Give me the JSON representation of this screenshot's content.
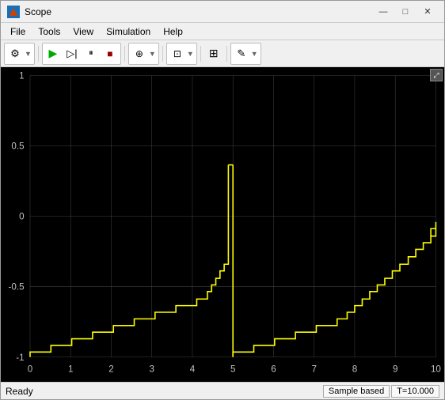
{
  "window": {
    "title": "Scope",
    "title_icon_color": "#d04000"
  },
  "titlebar_buttons": {
    "minimize": "—",
    "maximize": "□",
    "close": "✕"
  },
  "menu": {
    "items": [
      "File",
      "Tools",
      "View",
      "Simulation",
      "Help"
    ]
  },
  "toolbar": {
    "buttons": [
      {
        "name": "settings",
        "icon": "⚙"
      },
      {
        "name": "run",
        "icon": "▶"
      },
      {
        "name": "play",
        "icon": "▷"
      },
      {
        "name": "pause",
        "icon": "⏸"
      },
      {
        "name": "stop",
        "icon": "■"
      },
      {
        "name": "zoom-in",
        "icon": "🔍"
      },
      {
        "name": "zoom-box",
        "icon": "⊡"
      },
      {
        "name": "axes",
        "icon": "⊞"
      },
      {
        "name": "edit",
        "icon": "✎"
      }
    ]
  },
  "chart": {
    "background": "#000000",
    "grid_color": "#404040",
    "line_color": "#ffff00",
    "x_min": 0,
    "x_max": 10,
    "y_min": -1,
    "y_max": 1,
    "x_labels": [
      "0",
      "1",
      "2",
      "3",
      "4",
      "5",
      "6",
      "7",
      "8",
      "9",
      "10"
    ],
    "y_labels": [
      "-1",
      "-0.5",
      "0",
      "0.5",
      "1"
    ]
  },
  "status": {
    "ready": "Ready",
    "sample_based": "Sample based",
    "time": "T=10.000"
  }
}
